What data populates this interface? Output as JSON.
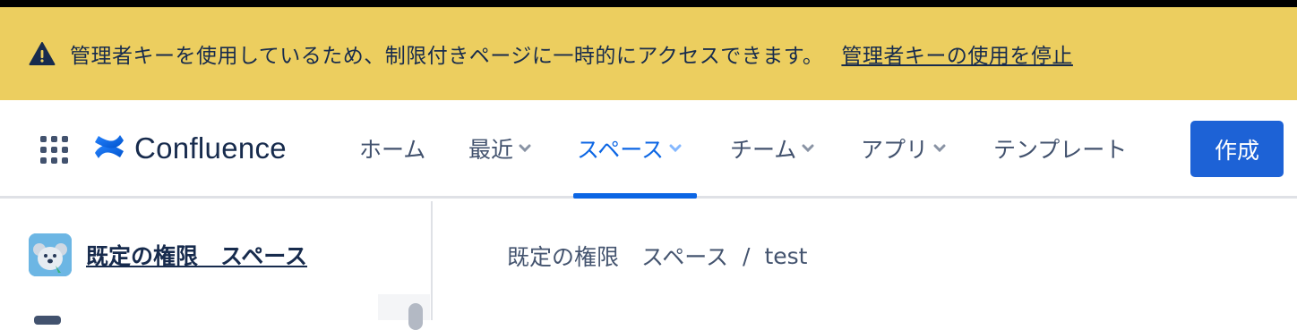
{
  "banner": {
    "message": "管理者キーを使用しているため、制限付きページに一時的にアクセスできます。",
    "stop_link": "管理者キーの使用を停止",
    "bg_color": "#ecce5f"
  },
  "header": {
    "brand": "Confluence",
    "nav": [
      {
        "label": "ホーム",
        "has_dropdown": false
      },
      {
        "label": "最近",
        "has_dropdown": true
      },
      {
        "label": "スペース",
        "has_dropdown": true,
        "active": true
      },
      {
        "label": "チーム",
        "has_dropdown": true
      },
      {
        "label": "アプリ",
        "has_dropdown": true
      },
      {
        "label": "テンプレート",
        "has_dropdown": false
      }
    ],
    "create_label": "作成",
    "accent_color": "#1d62d6"
  },
  "sidebar": {
    "space_name": "既定の権限　スペース"
  },
  "breadcrumb": {
    "space": "既定の権限　スペース",
    "separator": "/",
    "page": "test"
  }
}
